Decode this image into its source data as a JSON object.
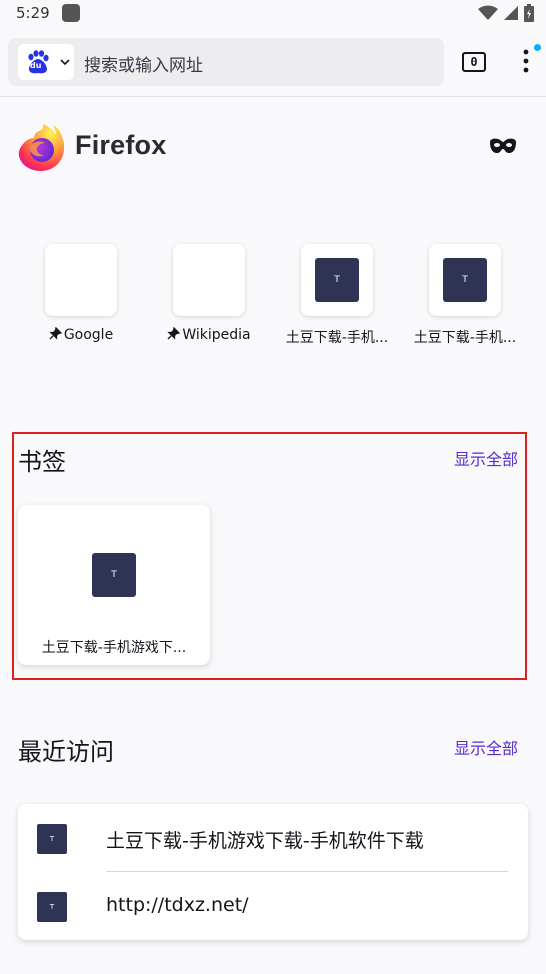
{
  "status_bar": {
    "time": "5:29",
    "icons": [
      "app-notification-icon",
      "wifi-icon",
      "signal-icon",
      "battery-icon"
    ]
  },
  "toolbar": {
    "search_engine_icon": "baidu-logo-icon",
    "search_engine_logo_text": "du",
    "url_placeholder": "搜索或输入网址",
    "tab_count": "0",
    "menu_icon": "more-vertical-icon"
  },
  "home": {
    "wordmark": "Firefox",
    "private_icon": "private-mask-icon"
  },
  "top_sites": [
    {
      "label": "Google",
      "pinned": true,
      "favicon": ""
    },
    {
      "label": "Wikipedia",
      "pinned": true,
      "favicon": ""
    },
    {
      "label": "土豆下载-手机...",
      "pinned": false,
      "favicon": "T"
    },
    {
      "label": "土豆下载-手机...",
      "pinned": false,
      "favicon": "T"
    }
  ],
  "bookmarks": {
    "title": "书签",
    "show_all": "显示全部",
    "items": [
      {
        "label": "土豆下载-手机游戏下...",
        "favicon": "T"
      }
    ]
  },
  "recent_visits": {
    "title": "最近访问",
    "show_all": "显示全部",
    "items": [
      {
        "label": "土豆下载-手机游戏下载-手机软件下载",
        "favicon": "T"
      },
      {
        "label": "http://tdxz.net/",
        "favicon": "T"
      }
    ]
  },
  "colors": {
    "accent": "#592acb",
    "highlight_border": "#e02020",
    "favicon_bg": "#2f3454",
    "notification_dot": "#00b3f4"
  }
}
